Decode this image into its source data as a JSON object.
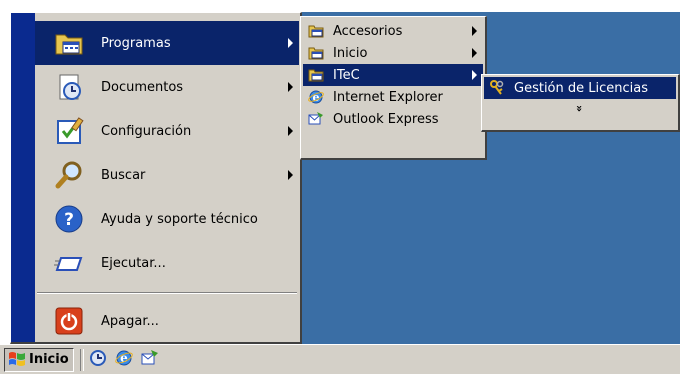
{
  "colors": {
    "highlight": "#0a246a",
    "menu_bg": "#d4d0c8",
    "desktop": "#3a6ea5",
    "side_band": "#0a2a8f"
  },
  "taskbar": {
    "start_label": "Inicio",
    "start_icon": "windows-flag-icon",
    "quick_launch": [
      "desktop-icon",
      "internet-explorer-icon",
      "outlook-express-icon"
    ]
  },
  "start_menu": {
    "items": [
      {
        "label": "Programas",
        "icon": "programs-folder-icon",
        "submenu": true,
        "highlighted": true
      },
      {
        "label": "Documentos",
        "icon": "documents-icon",
        "submenu": true
      },
      {
        "label": "Configuración",
        "icon": "settings-icon",
        "submenu": true
      },
      {
        "label": "Buscar",
        "icon": "search-icon",
        "submenu": true
      },
      {
        "label": "Ayuda y soporte técnico",
        "icon": "help-icon",
        "submenu": false
      },
      {
        "label": "Ejecutar...",
        "icon": "run-icon",
        "submenu": false
      }
    ],
    "shutdown": {
      "label": "Apagar...",
      "icon": "power-icon"
    }
  },
  "programs_menu": {
    "items": [
      {
        "label": "Accesorios",
        "icon": "program-group-icon",
        "submenu": true
      },
      {
        "label": "Inicio",
        "icon": "program-group-icon",
        "submenu": true
      },
      {
        "label": "ITeC",
        "icon": "program-group-icon",
        "submenu": true,
        "highlighted": true
      },
      {
        "label": "Internet Explorer",
        "icon": "internet-explorer-icon",
        "submenu": false
      },
      {
        "label": "Outlook Express",
        "icon": "outlook-express-icon",
        "submenu": false
      }
    ]
  },
  "itec_menu": {
    "items": [
      {
        "label": "Gestión de Licencias",
        "icon": "keys-icon",
        "highlighted": true
      }
    ],
    "expand_glyph": "»"
  }
}
